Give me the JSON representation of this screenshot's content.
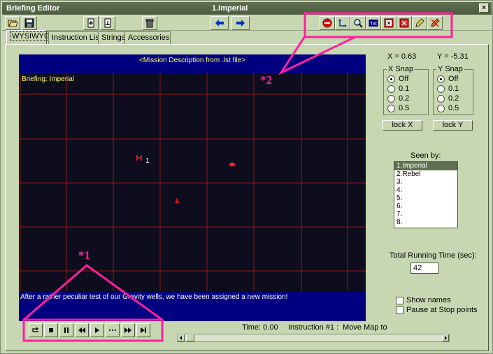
{
  "window": {
    "app_title": "Briefing Editor",
    "doc_title": "1.Imperial",
    "close_glyph": "×"
  },
  "toolbar": {
    "left_icons": [
      "folder-open-icon",
      "floppy-save-icon",
      "add-page-icon",
      "remove-page-icon",
      "trash-icon"
    ],
    "nav_icons": [
      "arrow-left-icon",
      "arrow-right-icon"
    ],
    "tool_icons": [
      "stop-sign-icon",
      "move-map-icon",
      "zoom-icon",
      "text-icon",
      "close-box-icon",
      "clear-box-icon",
      "pencil-icon",
      "erase-icon"
    ]
  },
  "tabs": [
    {
      "label": "WYSIWYG",
      "active": true
    },
    {
      "label": "Instruction List",
      "active": false
    },
    {
      "label": "Strings",
      "active": false
    },
    {
      "label": "Accessories",
      "active": false
    }
  ],
  "map": {
    "header": "<Mission Description from .lst file>",
    "briefing_label": "Briefing: Imperial",
    "footer_text": "After a rather peculiar test of our Gravity wells, we have been assigned a new mission!",
    "ship_label": "1",
    "colors": {
      "header_bg": "#000080",
      "grid": "#8b1a1a",
      "text_yellow": "#ffff60"
    }
  },
  "annotations": {
    "star1": "*1",
    "star2": "*2",
    "color": "#ff1f9f"
  },
  "coords": {
    "x": "X = 0.63",
    "y": "Y = -5.31"
  },
  "x_snap": {
    "legend": "X Snap",
    "options": [
      "Off",
      "0.1",
      "0.2",
      "0.5"
    ],
    "selected": "Off",
    "lock_label": "lock X"
  },
  "y_snap": {
    "legend": "Y Snap",
    "options": [
      "Off",
      "0.1",
      "0.2",
      "0.5"
    ],
    "selected": "Off",
    "lock_label": "lock Y"
  },
  "seen_by": {
    "label": "Seen by:",
    "items": [
      "1.Imperial",
      "2.Rebel",
      "3.",
      "4.",
      "5.",
      "6.",
      "7.",
      "8."
    ],
    "selected": "1.Imperial"
  },
  "running_time": {
    "label": "Total Running Time (sec):",
    "value": "42"
  },
  "options": [
    {
      "label": "Show names",
      "checked": false
    },
    {
      "label": "Pause at Stop points",
      "checked": false
    }
  ],
  "player": {
    "buttons": [
      "loop-icon",
      "stop-icon",
      "pause-icon",
      "rewind-icon",
      "play-icon",
      "step-icon",
      "fast-forward-icon",
      "skip-end-icon"
    ]
  },
  "status": {
    "time": "Time: 0.00",
    "instruction": "Instruction #1 :",
    "command": "Move Map to"
  }
}
